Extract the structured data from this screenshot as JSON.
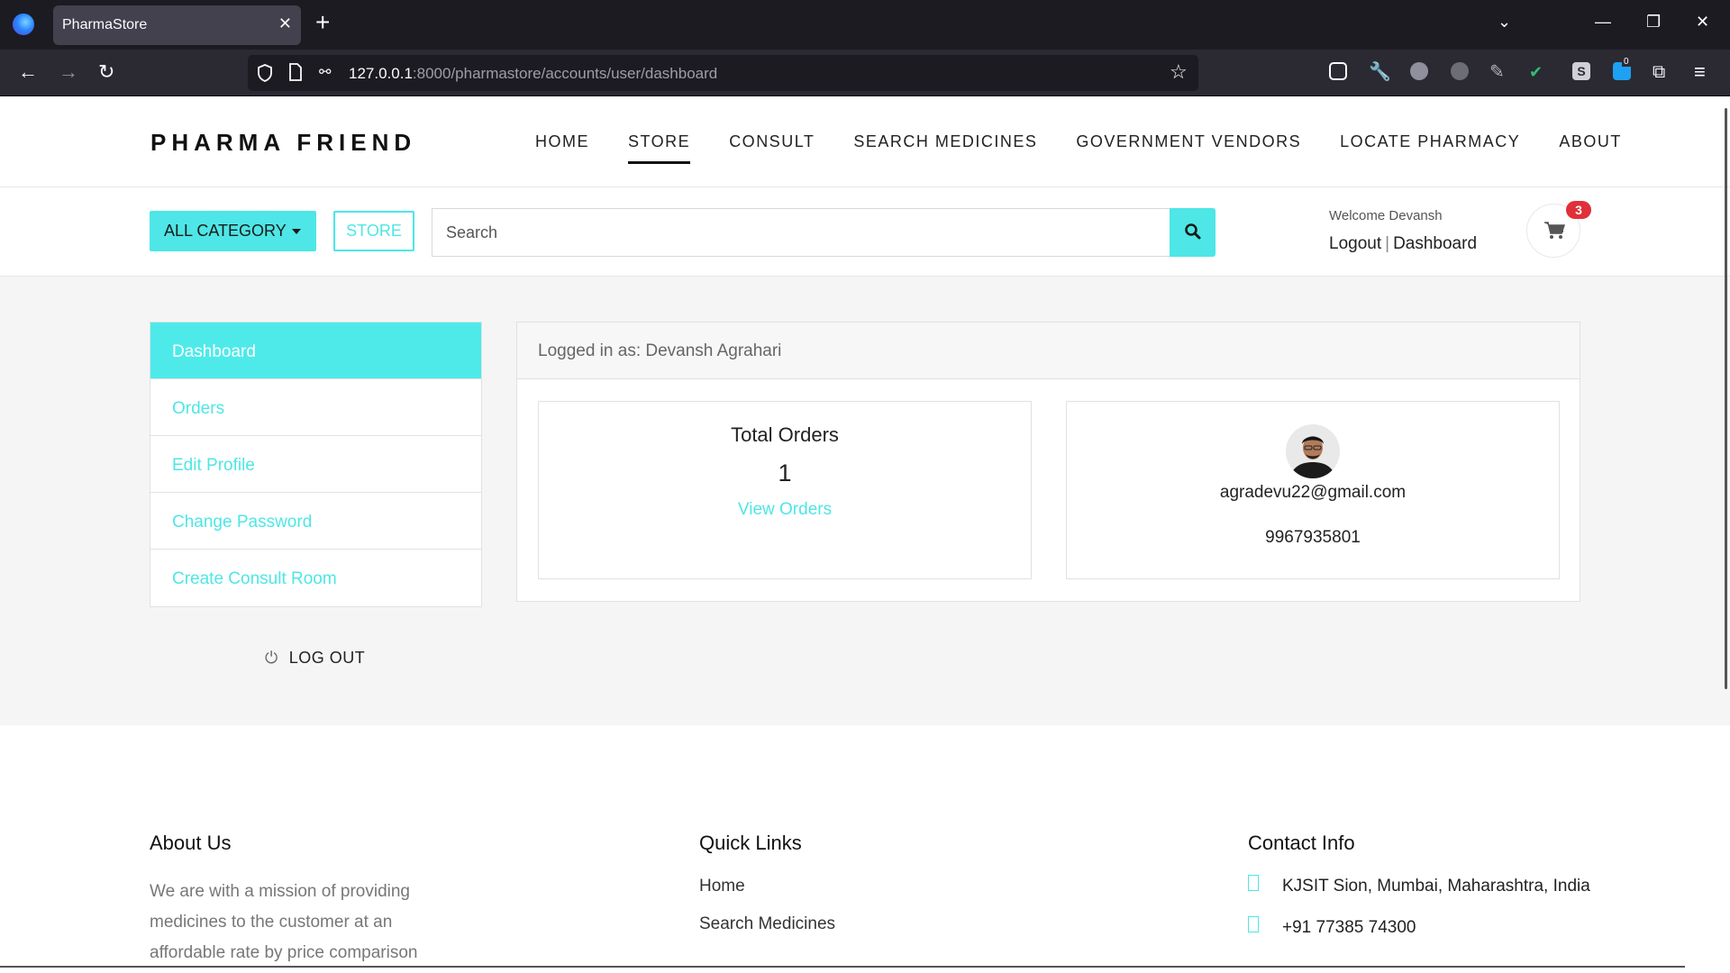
{
  "browser": {
    "tab_title": "PharmaStore",
    "url_host": "127.0.0.1",
    "url_rest": ":8000/pharmastore/accounts/user/dashboard",
    "ext_badge": "0"
  },
  "site": {
    "logo": "PHARMA FRIEND",
    "menu": [
      "HOME",
      "STORE",
      "CONSULT",
      "SEARCH MEDICINES",
      "GOVERNMENT VENDORS",
      "LOCATE PHARMACY",
      "ABOUT"
    ],
    "active_menu": "STORE",
    "accent": "#4ee6e6"
  },
  "searchbar": {
    "category_label": "ALL CATEGORY",
    "store_label": "STORE",
    "placeholder": "Search",
    "welcome": "Welcome Devansh",
    "logout_link": "Logout",
    "separator": "|",
    "dashboard_link": "Dashboard",
    "cart_count": "3"
  },
  "sidebar": {
    "items": [
      {
        "label": "Dashboard"
      },
      {
        "label": "Orders"
      },
      {
        "label": "Edit Profile"
      },
      {
        "label": "Change Password"
      },
      {
        "label": "Create Consult Room"
      }
    ],
    "logout_label": "LOG OUT"
  },
  "panel": {
    "header": "Logged in as: Devansh Agrahari",
    "orders_title": "Total Orders",
    "orders_count": "1",
    "orders_link": "View Orders",
    "email": "agradevu22@gmail.com",
    "phone": "9967935801"
  },
  "footer": {
    "about_title": "About Us",
    "about_text": "We are with a mission of providing medicines to the customer at an affordable rate by price comparison",
    "links_title": "Quick Links",
    "links": [
      "Home",
      "Search Medicines"
    ],
    "contact_title": "Contact Info",
    "address": "KJSIT Sion, Mumbai, Maharashtra, India",
    "phone": "+91 77385 74300"
  }
}
